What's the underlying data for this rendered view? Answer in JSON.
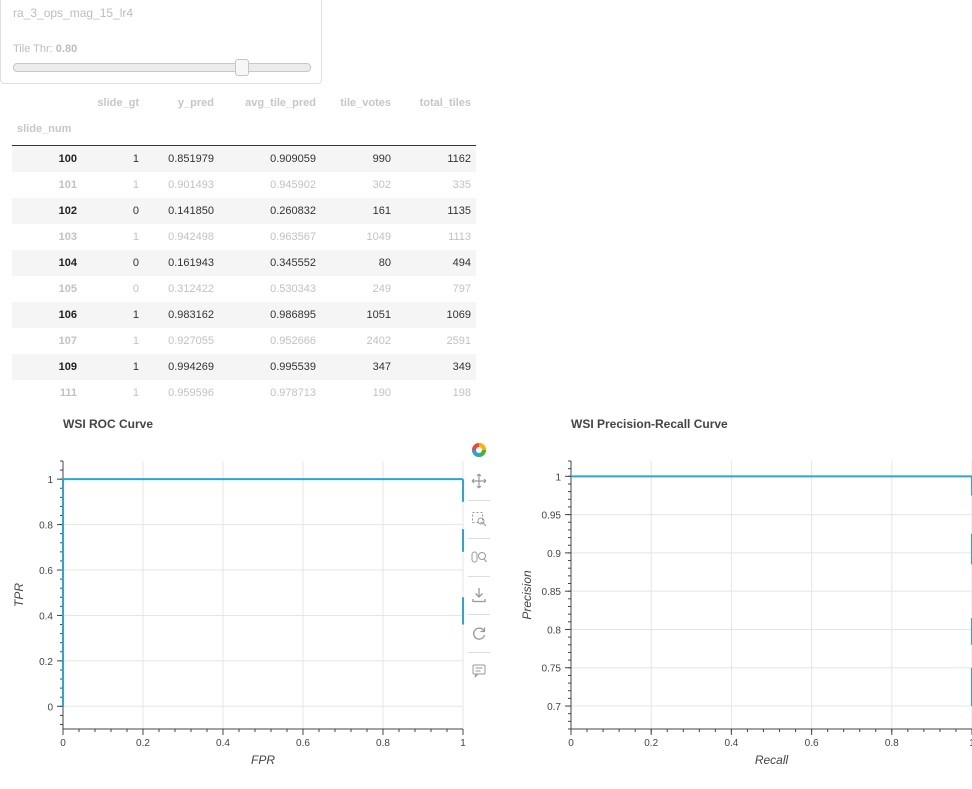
{
  "widget": {
    "model_name": "ra_3_ops_mag_15_lr4",
    "threshold_label": "Tile Thr:",
    "threshold_value": "0.80",
    "threshold_level": 0.8
  },
  "table": {
    "columns": [
      "slide_gt",
      "y_pred",
      "avg_tile_pred",
      "tile_votes",
      "total_tiles"
    ],
    "index_name": "slide_num",
    "rows": [
      {
        "slide_num": "100",
        "slide_gt": "1",
        "y_pred": "0.851979",
        "avg_tile_pred": "0.909059",
        "tile_votes": "990",
        "total_tiles": "1162"
      },
      {
        "slide_num": "101",
        "slide_gt": "1",
        "y_pred": "0.901493",
        "avg_tile_pred": "0.945902",
        "tile_votes": "302",
        "total_tiles": "335"
      },
      {
        "slide_num": "102",
        "slide_gt": "0",
        "y_pred": "0.141850",
        "avg_tile_pred": "0.260832",
        "tile_votes": "161",
        "total_tiles": "1135"
      },
      {
        "slide_num": "103",
        "slide_gt": "1",
        "y_pred": "0.942498",
        "avg_tile_pred": "0.963567",
        "tile_votes": "1049",
        "total_tiles": "1113"
      },
      {
        "slide_num": "104",
        "slide_gt": "0",
        "y_pred": "0.161943",
        "avg_tile_pred": "0.345552",
        "tile_votes": "80",
        "total_tiles": "494"
      },
      {
        "slide_num": "105",
        "slide_gt": "0",
        "y_pred": "0.312422",
        "avg_tile_pred": "0.530343",
        "tile_votes": "249",
        "total_tiles": "797"
      },
      {
        "slide_num": "106",
        "slide_gt": "1",
        "y_pred": "0.983162",
        "avg_tile_pred": "0.986895",
        "tile_votes": "1051",
        "total_tiles": "1069"
      },
      {
        "slide_num": "107",
        "slide_gt": "1",
        "y_pred": "0.927055",
        "avg_tile_pred": "0.952666",
        "tile_votes": "2402",
        "total_tiles": "2591"
      },
      {
        "slide_num": "109",
        "slide_gt": "1",
        "y_pred": "0.994269",
        "avg_tile_pred": "0.995539",
        "tile_votes": "347",
        "total_tiles": "349"
      },
      {
        "slide_num": "111",
        "slide_gt": "1",
        "y_pred": "0.959596",
        "avg_tile_pred": "0.978713",
        "tile_votes": "190",
        "total_tiles": "198"
      }
    ]
  },
  "toolbar": [
    "bokeh-logo-icon",
    "pan-icon",
    "box-zoom-icon",
    "wheel-zoom-icon",
    "save-icon",
    "reset-icon",
    "hover-icon"
  ],
  "colors": {
    "line": "#2ca5d6",
    "grid": "#e5e5e5",
    "axis": "#444444"
  },
  "chart_data": [
    {
      "type": "line",
      "title": "WSI ROC Curve",
      "xlabel": "FPR",
      "ylabel": "TPR",
      "xlim": [
        0,
        1
      ],
      "ylim": [
        -0.1,
        1.08
      ],
      "xticks": [
        0,
        0.2,
        0.4,
        0.6,
        0.8,
        1
      ],
      "yticks": [
        0,
        0.2,
        0.4,
        0.6,
        0.8,
        1
      ],
      "grid": true,
      "series": [
        {
          "x": [
            0,
            0,
            1,
            1
          ],
          "y": [
            0,
            1,
            1,
            1
          ]
        }
      ],
      "segments": [
        {
          "x": 1,
          "y": [
            0.9,
            1.0
          ]
        },
        {
          "x": 1,
          "y": [
            0.68,
            0.78
          ]
        },
        {
          "x": 1,
          "y": [
            0.36,
            0.48
          ]
        }
      ]
    },
    {
      "type": "line",
      "title": "WSI Precision-Recall Curve",
      "xlabel": "Recall",
      "ylabel": "Precision",
      "xlim": [
        0,
        1
      ],
      "ylim": [
        0.67,
        1.02
      ],
      "xticks": [
        0,
        0.2,
        0.4,
        0.6,
        0.8,
        1
      ],
      "yticks": [
        0.7,
        0.75,
        0.8,
        0.85,
        0.9,
        0.95,
        1
      ],
      "grid": true,
      "series": [
        {
          "x": [
            0,
            1,
            1
          ],
          "y": [
            1,
            1,
            1
          ]
        }
      ],
      "segments": [
        {
          "x": 1,
          "y": [
            0.975,
            1.0
          ]
        },
        {
          "x": 1,
          "y": [
            0.885,
            0.925
          ]
        },
        {
          "x": 1,
          "y": [
            0.78,
            0.815
          ]
        },
        {
          "x": 1,
          "y": [
            0.7,
            0.75
          ]
        }
      ]
    }
  ]
}
